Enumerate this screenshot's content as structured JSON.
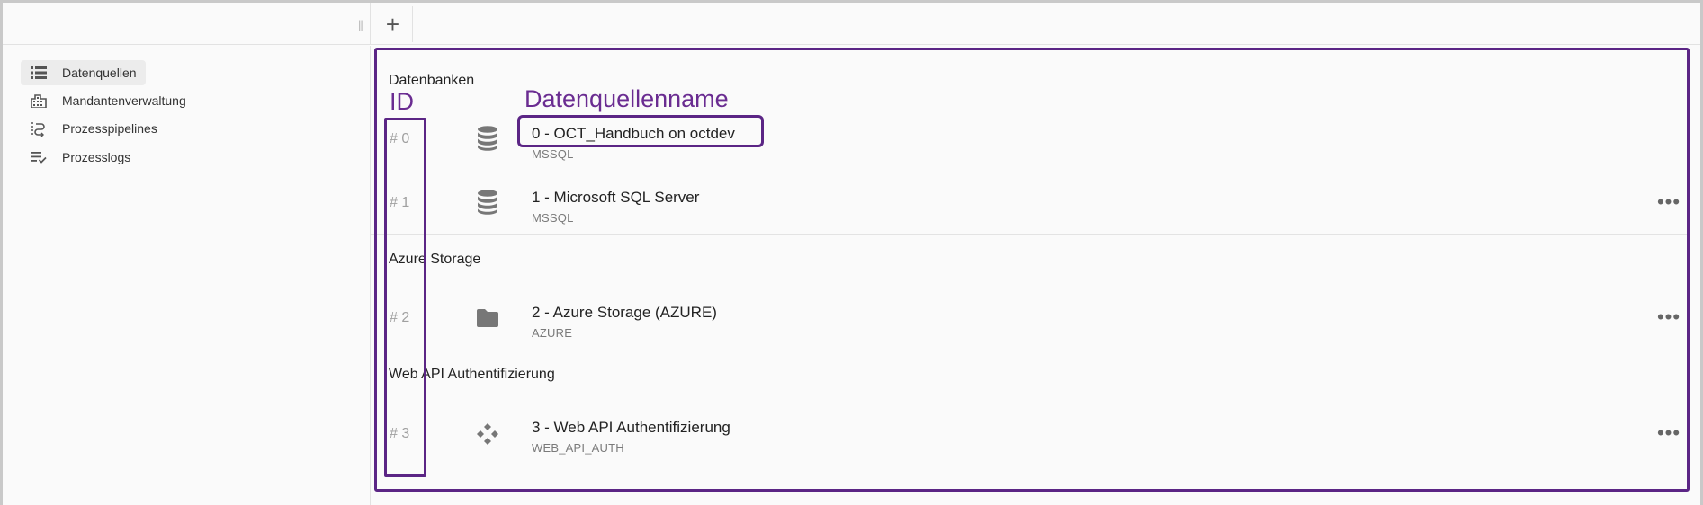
{
  "topbar": {
    "drag_handle": "||",
    "add_tab": "+"
  },
  "sidebar": {
    "items": [
      {
        "label": "Datenquellen",
        "icon": "list-icon",
        "active": true
      },
      {
        "label": "Mandantenverwaltung",
        "icon": "building-icon",
        "active": false
      },
      {
        "label": "Prozesspipelines",
        "icon": "pipeline-sort-icon",
        "active": false
      },
      {
        "label": "Prozesslogs",
        "icon": "list-check-icon",
        "active": false
      }
    ]
  },
  "annotations": {
    "id_label": "ID",
    "name_label": "Datenquellenname",
    "color": "#5b2585"
  },
  "sections": [
    {
      "title": "Datenbanken",
      "rows": [
        {
          "id": "# 0",
          "icon": "database-icon",
          "title": "0 - OCT_Handbuch on octdev",
          "subtitle": "MSSQL",
          "more": ""
        },
        {
          "id": "# 1",
          "icon": "database-icon",
          "title": "1 - Microsoft SQL Server",
          "subtitle": "MSSQL",
          "more": "•••"
        }
      ]
    },
    {
      "title": "Azure Storage",
      "rows": [
        {
          "id": "# 2",
          "icon": "folder-icon",
          "title": "2 - Azure Storage (AZURE)",
          "subtitle": "AZURE",
          "more": "•••"
        }
      ]
    },
    {
      "title": "Web API Authentifizierung",
      "rows": [
        {
          "id": "# 3",
          "icon": "api-icon",
          "title": "3 - Web API Authentifizierung",
          "subtitle": "WEB_API_AUTH",
          "more": "•••"
        }
      ]
    }
  ]
}
